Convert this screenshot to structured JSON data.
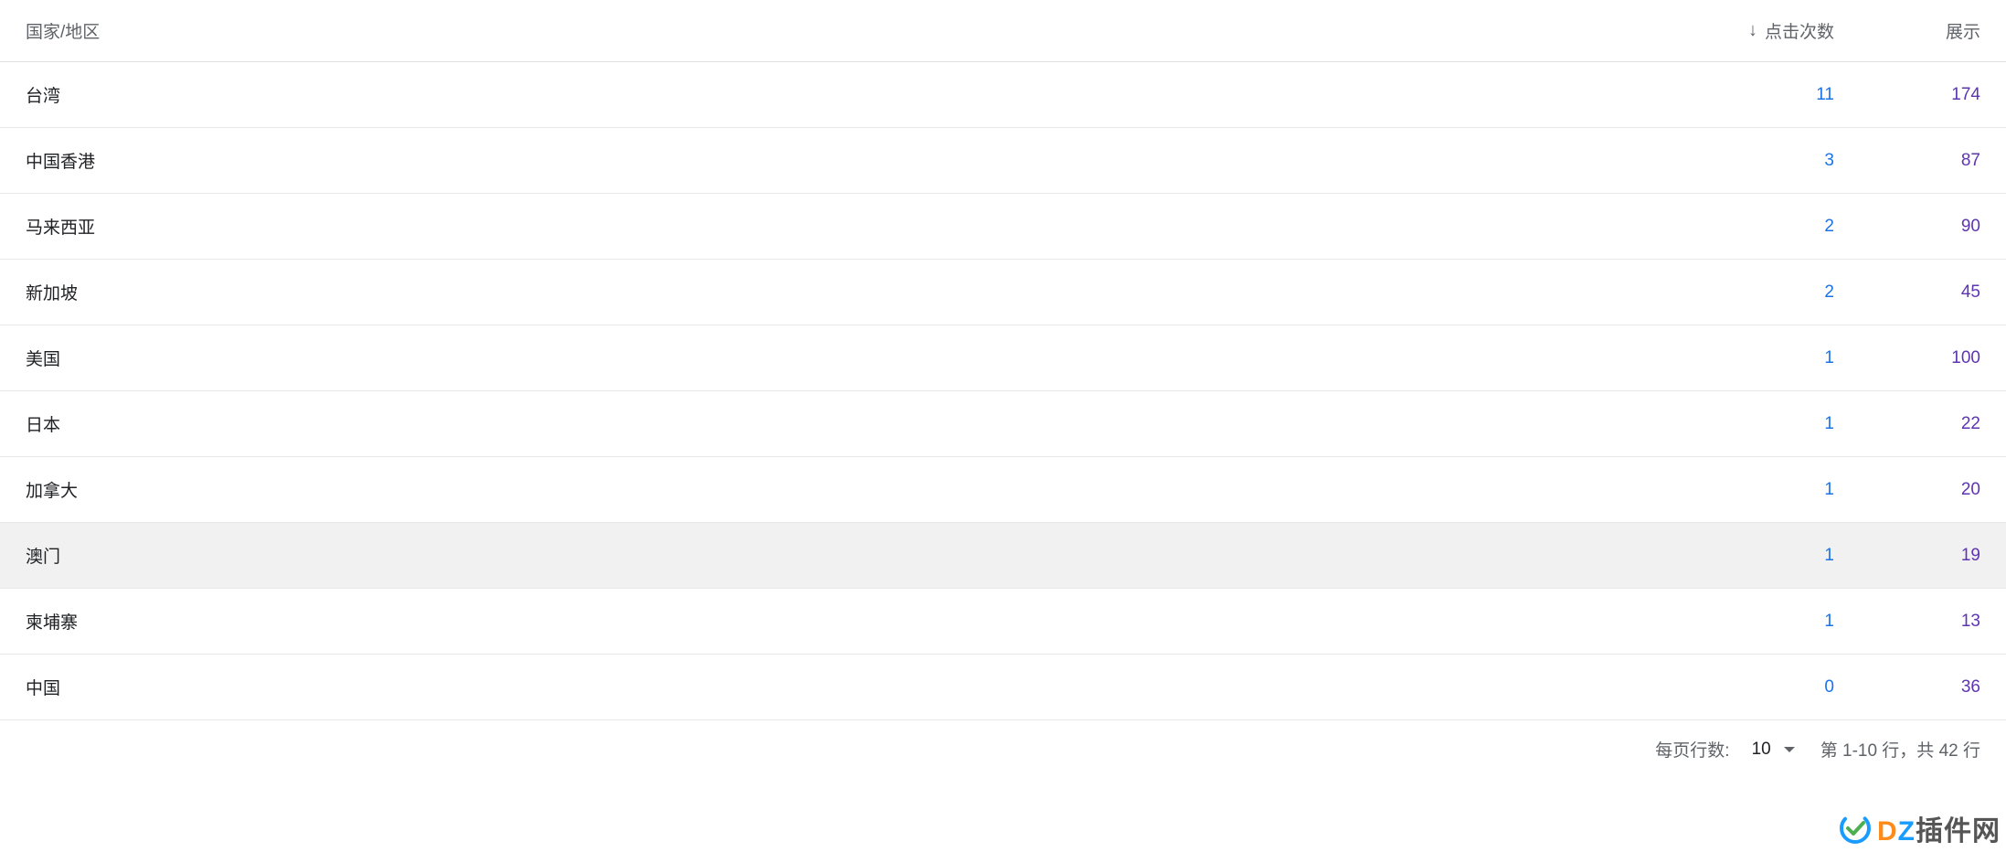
{
  "header": {
    "country": "国家/地区",
    "clicks": "点击次数",
    "impressions": "展示"
  },
  "rows": [
    {
      "country": "台湾",
      "clicks": "11",
      "impressions": "174",
      "highlighted": false
    },
    {
      "country": "中国香港",
      "clicks": "3",
      "impressions": "87",
      "highlighted": false
    },
    {
      "country": "马来西亚",
      "clicks": "2",
      "impressions": "90",
      "highlighted": false
    },
    {
      "country": "新加坡",
      "clicks": "2",
      "impressions": "45",
      "highlighted": false
    },
    {
      "country": "美国",
      "clicks": "1",
      "impressions": "100",
      "highlighted": false
    },
    {
      "country": "日本",
      "clicks": "1",
      "impressions": "22",
      "highlighted": false
    },
    {
      "country": "加拿大",
      "clicks": "1",
      "impressions": "20",
      "highlighted": false
    },
    {
      "country": "澳门",
      "clicks": "1",
      "impressions": "19",
      "highlighted": true
    },
    {
      "country": "柬埔寨",
      "clicks": "1",
      "impressions": "13",
      "highlighted": false
    },
    {
      "country": "中国",
      "clicks": "0",
      "impressions": "36",
      "highlighted": false
    }
  ],
  "footer": {
    "rows_per_page_label": "每页行数:",
    "rows_per_page_value": "10",
    "page_range": "第 1-10 行，共 42 行"
  },
  "watermark": {
    "text_d": "D",
    "text_z": "Z",
    "text_rest": "插件网"
  }
}
